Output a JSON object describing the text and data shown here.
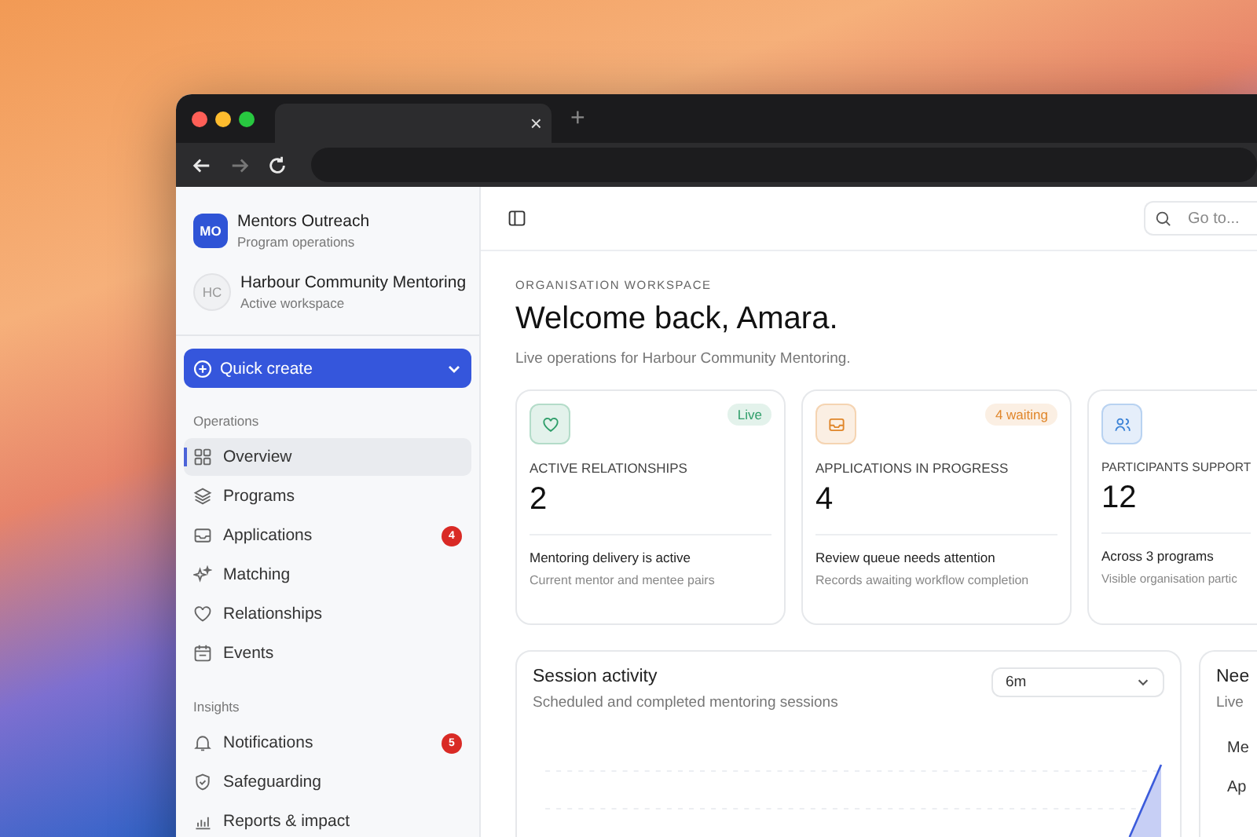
{
  "browser": {
    "tab": {
      "close": "×"
    },
    "new_tab": "+",
    "nav_buttons": [
      {
        "kind": "back",
        "disabled": false
      },
      {
        "kind": "forward",
        "disabled": true
      },
      {
        "kind": "reload",
        "disabled": false
      }
    ]
  },
  "sidebar": {
    "workspaces": [
      {
        "initials": "MO",
        "name": "Mentors Outreach",
        "subtitle": "Program operations",
        "kind": "org"
      },
      {
        "initials": "HC",
        "name": "Harbour Community Mentoring",
        "subtitle": "Active workspace",
        "kind": "workspace"
      }
    ],
    "quick_create": "Quick create",
    "sections": [
      {
        "title": "Operations",
        "items": [
          {
            "label": "Overview",
            "kind": "grid",
            "selected": true
          },
          {
            "label": "Programs",
            "kind": "layers",
            "selected": false
          },
          {
            "label": "Applications",
            "kind": "inbox",
            "selected": false,
            "badge": "4"
          },
          {
            "label": "Matching",
            "kind": "sparkles",
            "selected": false
          },
          {
            "label": "Relationships",
            "kind": "heart",
            "selected": false
          },
          {
            "label": "Events",
            "kind": "calendar",
            "selected": false
          }
        ]
      },
      {
        "title": "Insights",
        "items": [
          {
            "label": "Notifications",
            "kind": "bell",
            "selected": false,
            "badge": "5"
          },
          {
            "label": "Safeguarding",
            "kind": "shield",
            "selected": false
          },
          {
            "label": "Reports & impact",
            "kind": "chart",
            "selected": false
          }
        ]
      }
    ]
  },
  "topbar": {
    "search": {
      "placeholder": "Go to..."
    }
  },
  "header": {
    "eyebrow": "ORGANISATION WORKSPACE",
    "title": "Welcome back, Amara.",
    "subtitle": "Live operations for Harbour Community Mentoring."
  },
  "stat_cards": [
    {
      "kind": "heart",
      "color": "#2f9e6a",
      "badge": "Live",
      "label": "ACTIVE RELATIONSHIPS",
      "value": "2",
      "note": "Mentoring delivery is active",
      "detail": "Current mentor and mentee pairs"
    },
    {
      "kind": "inbox",
      "color": "#e0862a",
      "badge": "4 waiting",
      "label": "APPLICATIONS IN PROGRESS",
      "value": "4",
      "note": "Review queue needs attention",
      "detail": "Records awaiting workflow completion"
    },
    {
      "kind": "users",
      "color": "#3b82d6",
      "label": "PARTICIPANTS SUPPORT",
      "value": "12",
      "note": "Across 3 programs",
      "detail": "Visible organisation partic"
    }
  ],
  "session_activity": {
    "title": "Session activity",
    "subtitle": "Scheduled and completed mentoring sessions",
    "range": "6m"
  },
  "side_panel": {
    "title": "Nee",
    "subtitle": "Live",
    "rows": [
      "Me",
      "Ap"
    ]
  }
}
